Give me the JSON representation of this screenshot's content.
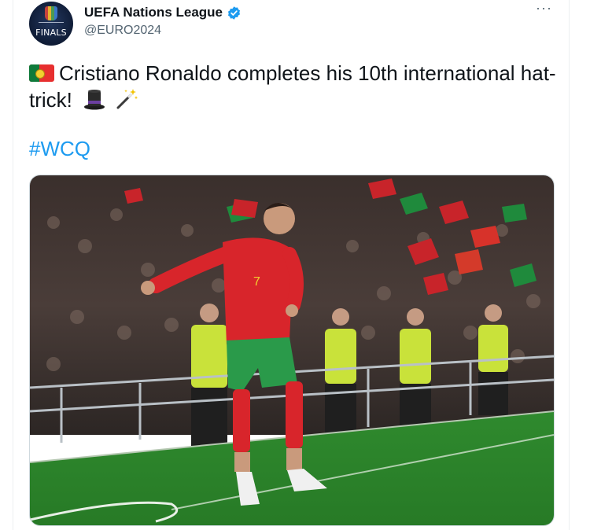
{
  "account": {
    "display_name": "UEFA Nations League",
    "handle": "@EURO2024",
    "avatar_text": "FINALS",
    "verified": true
  },
  "tweet": {
    "text_line": "Cristiano Ronaldo completes his 10th international hat-trick!",
    "hashtag": "#WCQ",
    "emoji": [
      "portugal-flag",
      "top-hat",
      "magic-wand"
    ]
  },
  "media": {
    "alt": "Player in red and green kit celebrating on pitch in front of crowd waving flags",
    "jersey_number": "7"
  },
  "colors": {
    "link": "#1d9bf0",
    "verified_badge": "#1d9bf0",
    "muted_text": "#536471",
    "pitch": "#2f8a2e",
    "kit_red": "#d8252b",
    "kit_green": "#2a9a4a"
  },
  "menu": {
    "more_label": "···"
  }
}
